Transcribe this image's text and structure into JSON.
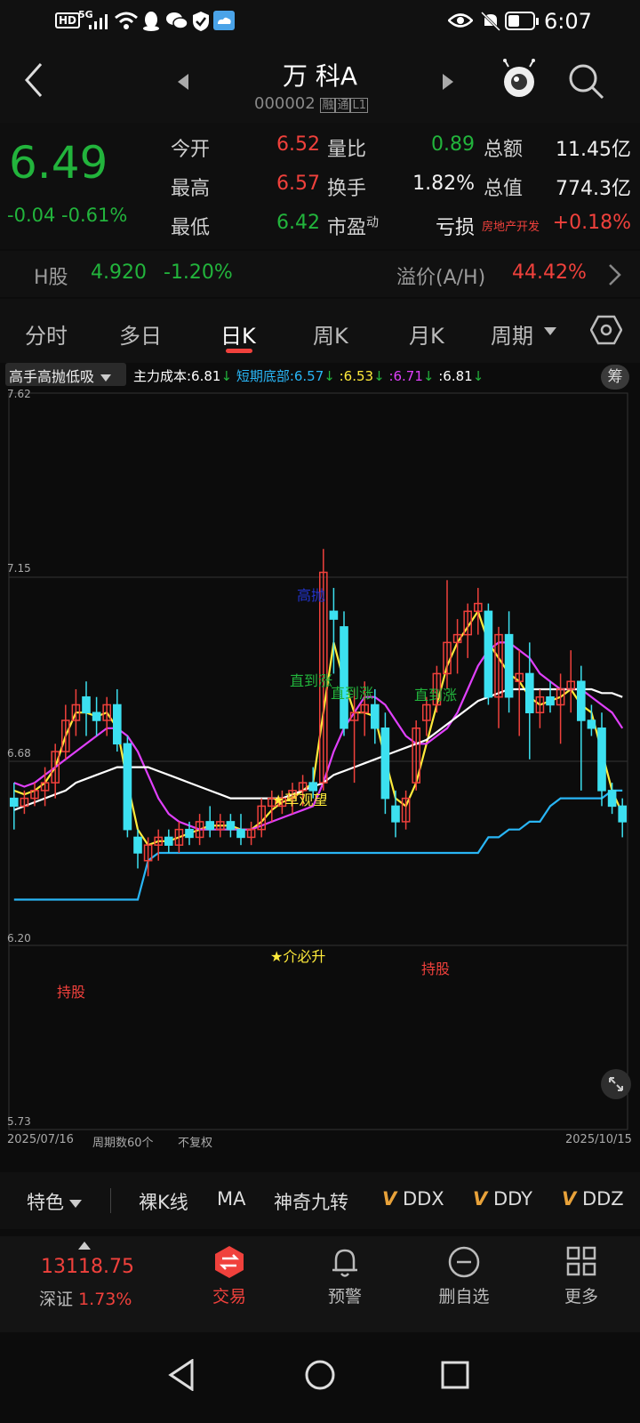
{
  "status": {
    "time": "6:07",
    "net": "5G",
    "hd": "HD"
  },
  "nav": {
    "title": "万 科A",
    "code": "000002",
    "badges": [
      "融",
      "通",
      "L1"
    ]
  },
  "quote": {
    "price": "6.49",
    "change": "-0.04",
    "change_pct": "-0.61%",
    "rows": [
      {
        "l1": "今开",
        "v1": "6.52",
        "l2": "量比",
        "v2": "0.89",
        "l3": "总额",
        "v3": "11.45亿"
      },
      {
        "l1": "最高",
        "v1": "6.57",
        "l2": "换手",
        "v2": "1.82%",
        "l3": "总值",
        "v3": "774.3亿"
      },
      {
        "l1": "最低",
        "v1": "6.42",
        "l2": "市盈",
        "l2_sup": "动",
        "v2": "亏损",
        "l3": "房地产开发",
        "v3": "+0.18%"
      }
    ]
  },
  "hshare": {
    "label": "H股",
    "price": "4.920",
    "pct": "-1.20%",
    "premium_label": "溢价(A/H)",
    "premium": "44.42%"
  },
  "tabs": {
    "items": [
      "分时",
      "多日",
      "日K",
      "周K",
      "月K",
      "周期"
    ],
    "active": 2
  },
  "chart": {
    "indicator_select": "高手高抛低吸",
    "legend": [
      {
        "text": "主力成本:6.81",
        "color": "#ffffff",
        "arrow": "↓"
      },
      {
        "text": "短期底部:6.57",
        "color": "#29b6f6",
        "arrow": "↓"
      },
      {
        "text": ":6.53",
        "color": "#ffeb3b",
        "arrow": "↓"
      },
      {
        "text": ":6.71",
        "color": "#e040fb",
        "arrow": "↓"
      },
      {
        "text": ":6.81",
        "color": "#ffffff",
        "arrow": "↓"
      }
    ],
    "chip_label": "筹",
    "y_labels": [
      "7.62",
      "7.15",
      "6.68",
      "6.20",
      "5.73"
    ],
    "start_date": "2025/07/16",
    "end_date": "2025/10/15",
    "period_count": "周期数60个",
    "adjust": "不复权",
    "annotations": [
      {
        "text": "高抛",
        "color": "#2233cc"
      },
      {
        "text": "直到涨",
        "color": "#22b43c"
      },
      {
        "text": "直到涨",
        "color": "#22b43c"
      },
      {
        "text": "直到涨",
        "color": "#22b43c"
      },
      {
        "text": "★草观望",
        "color": "#ffeb3b"
      },
      {
        "text": "★介必升",
        "color": "#ffeb3b"
      },
      {
        "text": "持股",
        "color": "#f0413c"
      },
      {
        "text": "持股",
        "color": "#f0413c"
      }
    ]
  },
  "indicators": {
    "special": "特色",
    "items": [
      "裸K线",
      "MA",
      "神奇九转",
      "DDX",
      "DDY",
      "DDZ"
    ]
  },
  "bottom": {
    "index_value": "13118.75",
    "index_name": "深证",
    "index_pct": "1.73%",
    "items": [
      "交易",
      "预警",
      "删自选",
      "更多"
    ]
  },
  "chart_data": {
    "type": "candlestick",
    "x_range": [
      "2025/07/16",
      "2025/10/15"
    ],
    "ylim": [
      5.73,
      7.62
    ],
    "candles": [
      {
        "o": 6.58,
        "h": 6.62,
        "l": 6.5,
        "c": 6.56
      },
      {
        "o": 6.56,
        "h": 6.6,
        "l": 6.54,
        "c": 6.58
      },
      {
        "o": 6.58,
        "h": 6.62,
        "l": 6.56,
        "c": 6.6
      },
      {
        "o": 6.6,
        "h": 6.66,
        "l": 6.56,
        "c": 6.62
      },
      {
        "o": 6.62,
        "h": 6.72,
        "l": 6.58,
        "c": 6.7
      },
      {
        "o": 6.7,
        "h": 6.82,
        "l": 6.68,
        "c": 6.78
      },
      {
        "o": 6.78,
        "h": 6.86,
        "l": 6.74,
        "c": 6.82
      },
      {
        "o": 6.84,
        "h": 6.88,
        "l": 6.74,
        "c": 6.8
      },
      {
        "o": 6.8,
        "h": 6.84,
        "l": 6.74,
        "c": 6.78
      },
      {
        "o": 6.78,
        "h": 6.84,
        "l": 6.74,
        "c": 6.82
      },
      {
        "o": 6.82,
        "h": 6.86,
        "l": 6.7,
        "c": 6.72
      },
      {
        "o": 6.72,
        "h": 6.74,
        "l": 6.48,
        "c": 6.5
      },
      {
        "o": 6.48,
        "h": 6.5,
        "l": 6.4,
        "c": 6.44
      },
      {
        "o": 6.42,
        "h": 6.48,
        "l": 6.38,
        "c": 6.46
      },
      {
        "o": 6.46,
        "h": 6.5,
        "l": 6.42,
        "c": 6.48
      },
      {
        "o": 6.48,
        "h": 6.5,
        "l": 6.44,
        "c": 6.46
      },
      {
        "o": 6.46,
        "h": 6.52,
        "l": 6.44,
        "c": 6.5
      },
      {
        "o": 6.5,
        "h": 6.52,
        "l": 6.46,
        "c": 6.48
      },
      {
        "o": 6.48,
        "h": 6.54,
        "l": 6.46,
        "c": 6.52
      },
      {
        "o": 6.52,
        "h": 6.56,
        "l": 6.48,
        "c": 6.5
      },
      {
        "o": 6.5,
        "h": 6.54,
        "l": 6.48,
        "c": 6.52
      },
      {
        "o": 6.52,
        "h": 6.54,
        "l": 6.48,
        "c": 6.5
      },
      {
        "o": 6.5,
        "h": 6.54,
        "l": 6.46,
        "c": 6.48
      },
      {
        "o": 6.48,
        "h": 6.52,
        "l": 6.46,
        "c": 6.5
      },
      {
        "o": 6.5,
        "h": 6.58,
        "l": 6.48,
        "c": 6.56
      },
      {
        "o": 6.56,
        "h": 6.6,
        "l": 6.52,
        "c": 6.58
      },
      {
        "o": 6.56,
        "h": 6.6,
        "l": 6.54,
        "c": 6.58
      },
      {
        "o": 6.58,
        "h": 6.62,
        "l": 6.54,
        "c": 6.6
      },
      {
        "o": 6.6,
        "h": 6.64,
        "l": 6.56,
        "c": 6.62
      },
      {
        "o": 6.62,
        "h": 6.66,
        "l": 6.58,
        "c": 6.6
      },
      {
        "o": 6.62,
        "h": 7.22,
        "l": 6.6,
        "c": 7.16
      },
      {
        "o": 7.06,
        "h": 7.12,
        "l": 6.9,
        "c": 7.04
      },
      {
        "o": 7.02,
        "h": 7.06,
        "l": 6.74,
        "c": 6.76
      },
      {
        "o": 6.78,
        "h": 6.86,
        "l": 6.62,
        "c": 6.8
      },
      {
        "o": 6.8,
        "h": 6.88,
        "l": 6.74,
        "c": 6.82
      },
      {
        "o": 6.82,
        "h": 6.86,
        "l": 6.72,
        "c": 6.76
      },
      {
        "o": 6.76,
        "h": 6.8,
        "l": 6.54,
        "c": 6.58
      },
      {
        "o": 6.56,
        "h": 6.6,
        "l": 6.48,
        "c": 6.52
      },
      {
        "o": 6.52,
        "h": 6.6,
        "l": 6.5,
        "c": 6.58
      },
      {
        "o": 6.62,
        "h": 6.78,
        "l": 6.6,
        "c": 6.76
      },
      {
        "o": 6.78,
        "h": 6.84,
        "l": 6.74,
        "c": 6.82
      },
      {
        "o": 6.82,
        "h": 6.92,
        "l": 6.8,
        "c": 6.9
      },
      {
        "o": 6.9,
        "h": 7.14,
        "l": 6.86,
        "c": 6.98
      },
      {
        "o": 6.98,
        "h": 7.04,
        "l": 6.9,
        "c": 7.0
      },
      {
        "o": 7.0,
        "h": 7.08,
        "l": 6.94,
        "c": 7.06
      },
      {
        "o": 7.06,
        "h": 7.12,
        "l": 7.0,
        "c": 7.08
      },
      {
        "o": 7.06,
        "h": 7.08,
        "l": 6.82,
        "c": 6.84
      },
      {
        "o": 6.84,
        "h": 7.02,
        "l": 6.76,
        "c": 7.0
      },
      {
        "o": 7.0,
        "h": 7.06,
        "l": 6.8,
        "c": 6.84
      },
      {
        "o": 6.88,
        "h": 6.96,
        "l": 6.74,
        "c": 6.9
      },
      {
        "o": 6.9,
        "h": 6.98,
        "l": 6.68,
        "c": 6.8
      },
      {
        "o": 6.8,
        "h": 6.86,
        "l": 6.76,
        "c": 6.84
      },
      {
        "o": 6.84,
        "h": 6.88,
        "l": 6.8,
        "c": 6.82
      },
      {
        "o": 6.82,
        "h": 6.9,
        "l": 6.72,
        "c": 6.86
      },
      {
        "o": 6.86,
        "h": 6.96,
        "l": 6.8,
        "c": 6.88
      },
      {
        "o": 6.88,
        "h": 6.92,
        "l": 6.6,
        "c": 6.78
      },
      {
        "o": 6.78,
        "h": 6.82,
        "l": 6.74,
        "c": 6.76
      },
      {
        "o": 6.76,
        "h": 6.8,
        "l": 6.56,
        "c": 6.6
      },
      {
        "o": 6.6,
        "h": 6.62,
        "l": 6.54,
        "c": 6.56
      },
      {
        "o": 6.56,
        "h": 6.58,
        "l": 6.48,
        "c": 6.52
      }
    ],
    "series": [
      {
        "color": "#ffeb3b",
        "values": [
          6.6,
          6.59,
          6.6,
          6.62,
          6.66,
          6.74,
          6.8,
          6.8,
          6.79,
          6.8,
          6.76,
          6.62,
          6.5,
          6.46,
          6.47,
          6.47,
          6.48,
          6.49,
          6.5,
          6.51,
          6.51,
          6.51,
          6.5,
          6.5,
          6.52,
          6.55,
          6.57,
          6.58,
          6.6,
          6.62,
          6.8,
          6.98,
          6.88,
          6.8,
          6.8,
          6.79,
          6.68,
          6.58,
          6.56,
          6.62,
          6.72,
          6.82,
          6.92,
          6.98,
          7.02,
          7.06,
          6.98,
          6.94,
          6.9,
          6.88,
          6.84,
          6.82,
          6.83,
          6.84,
          6.86,
          6.82,
          6.8,
          6.7,
          6.6,
          6.54
        ]
      },
      {
        "color": "#e040fb",
        "values": [
          6.62,
          6.61,
          6.62,
          6.64,
          6.66,
          6.68,
          6.7,
          6.72,
          6.74,
          6.76,
          6.76,
          6.74,
          6.7,
          6.64,
          6.58,
          6.54,
          6.52,
          6.51,
          6.5,
          6.5,
          6.5,
          6.5,
          6.5,
          6.5,
          6.51,
          6.52,
          6.53,
          6.54,
          6.55,
          6.56,
          6.62,
          6.7,
          6.76,
          6.8,
          6.84,
          6.84,
          6.82,
          6.78,
          6.74,
          6.72,
          6.72,
          6.74,
          6.76,
          6.8,
          6.86,
          6.92,
          6.96,
          6.98,
          6.98,
          6.96,
          6.94,
          6.9,
          6.88,
          6.86,
          6.86,
          6.86,
          6.84,
          6.82,
          6.8,
          6.76
        ]
      },
      {
        "color": "#ffffff",
        "values": [
          6.55,
          6.56,
          6.57,
          6.58,
          6.59,
          6.6,
          6.62,
          6.63,
          6.64,
          6.65,
          6.66,
          6.66,
          6.66,
          6.66,
          6.65,
          6.64,
          6.63,
          6.62,
          6.61,
          6.6,
          6.59,
          6.58,
          6.58,
          6.58,
          6.58,
          6.58,
          6.58,
          6.59,
          6.6,
          6.61,
          6.62,
          6.64,
          6.65,
          6.66,
          6.67,
          6.68,
          6.69,
          6.7,
          6.71,
          6.72,
          6.73,
          6.75,
          6.77,
          6.79,
          6.81,
          6.83,
          6.84,
          6.85,
          6.86,
          6.86,
          6.86,
          6.86,
          6.86,
          6.86,
          6.86,
          6.86,
          6.86,
          6.85,
          6.85,
          6.84
        ]
      },
      {
        "color": "#29b6f6",
        "values": [
          6.32,
          6.32,
          6.32,
          6.32,
          6.32,
          6.32,
          6.32,
          6.32,
          6.32,
          6.32,
          6.32,
          6.32,
          6.32,
          6.42,
          6.44,
          6.44,
          6.44,
          6.44,
          6.44,
          6.44,
          6.44,
          6.44,
          6.44,
          6.44,
          6.44,
          6.44,
          6.44,
          6.44,
          6.44,
          6.44,
          6.44,
          6.44,
          6.44,
          6.44,
          6.44,
          6.44,
          6.44,
          6.44,
          6.44,
          6.44,
          6.44,
          6.44,
          6.44,
          6.44,
          6.44,
          6.44,
          6.48,
          6.48,
          6.5,
          6.5,
          6.52,
          6.52,
          6.56,
          6.58,
          6.58,
          6.58,
          6.58,
          6.58,
          6.6,
          6.6
        ]
      }
    ]
  }
}
